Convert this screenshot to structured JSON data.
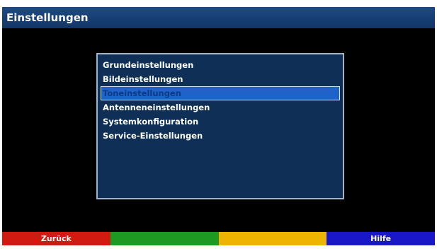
{
  "header": {
    "title": "Einstellungen"
  },
  "menu": {
    "items": [
      {
        "label": "Grundeinstellungen"
      },
      {
        "label": "Bildeinstellungen"
      },
      {
        "label": "Toneinstellungen"
      },
      {
        "label": "Antenneneinstellungen"
      },
      {
        "label": "Systemkonfiguration"
      },
      {
        "label": "Service-Einstellungen"
      }
    ],
    "selected_index": 2
  },
  "footer": {
    "red_label": "Zurück",
    "green_label": "",
    "yellow_label": "",
    "blue_label": "Hilfe"
  },
  "colors": {
    "header_bg": "#1d4a84",
    "panel_bg": "#0f2f56",
    "selection": "#1f63c9",
    "red": "#d11b10",
    "green": "#1e9a23",
    "yellow": "#efb400",
    "blue": "#1818c8"
  }
}
